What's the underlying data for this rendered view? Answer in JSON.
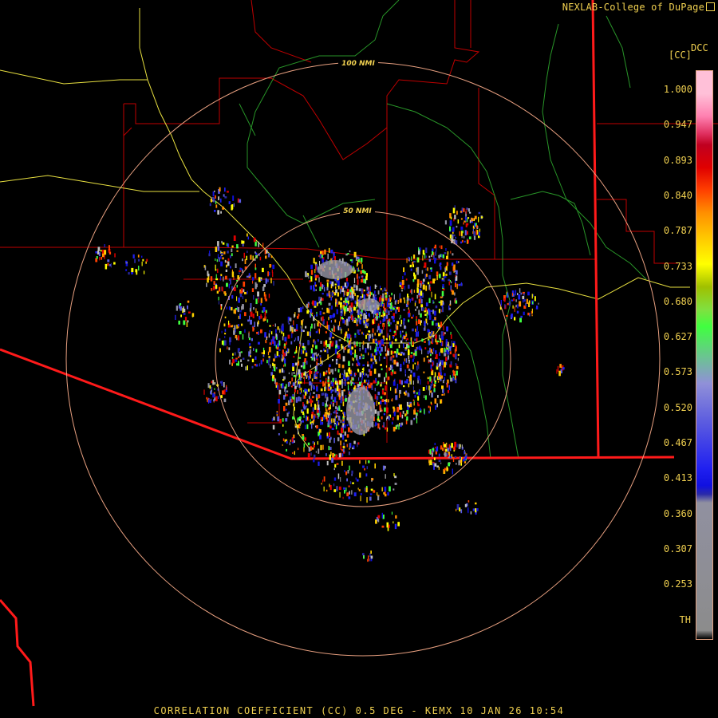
{
  "credit": "NEXLAB-College of DuPage",
  "legend": {
    "product_code": "DCC",
    "unit": "[CC]",
    "ticks": [
      "1.000",
      "0.947",
      "0.893",
      "0.840",
      "0.787",
      "0.733",
      "0.680",
      "0.627",
      "0.573",
      "0.520",
      "0.467",
      "0.413",
      "0.360",
      "0.307",
      "0.253",
      "TH"
    ],
    "colors": [
      "#000000",
      "#8c8c8c",
      "#9090a0",
      "#2a2aa8",
      "#1010e0",
      "#2020f0",
      "#5a5ae0",
      "#9090d8",
      "#40ff40",
      "#80e040",
      "#a0c000",
      "#ffff00",
      "#ffd000",
      "#ff9000",
      "#ff4000",
      "#e00000",
      "#c00020",
      "#e03060",
      "#ff80b0",
      "#ffc0d8"
    ]
  },
  "rings": [
    {
      "label": "50 NMI"
    },
    {
      "label": "100 NMI"
    }
  ],
  "footer": "CORRELATION COEFFICIENT (CC) 0.5 DEG - KEMX 10 JAN 26 10:54"
}
